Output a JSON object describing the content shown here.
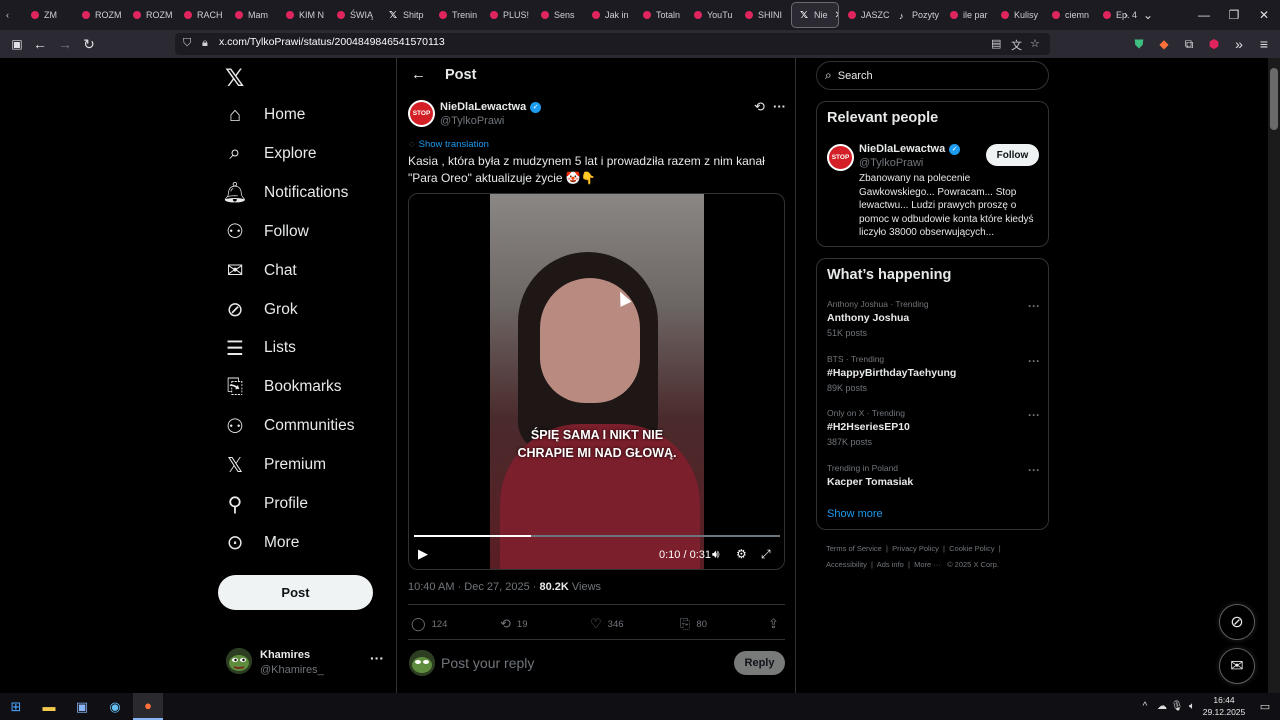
{
  "browser": {
    "tabs": [
      {
        "label": "ZM",
        "icon": "tab-favicon",
        "color": "#e0245e"
      },
      {
        "label": "ROZM",
        "icon": "youtube-favicon",
        "color": "#e0245e"
      },
      {
        "label": "ROZM",
        "icon": "youtube-favicon",
        "color": "#e0245e"
      },
      {
        "label": "RACH",
        "icon": "youtube-favicon",
        "color": "#e0245e"
      },
      {
        "label": "Mam",
        "icon": "youtube-favicon",
        "color": "#e0245e"
      },
      {
        "label": "KIM N",
        "icon": "youtube-favicon",
        "color": "#e0245e"
      },
      {
        "label": "ŚWIĄ",
        "icon": "youtube-favicon",
        "color": "#e0245e"
      },
      {
        "label": "Shitp",
        "icon": "x-favicon",
        "color": "#ffffff"
      },
      {
        "label": "Trenin",
        "icon": "youtube-favicon",
        "color": "#e0245e"
      },
      {
        "label": "PLUS!",
        "icon": "youtube-favicon",
        "color": "#e0245e"
      },
      {
        "label": "Sens",
        "icon": "youtube-favicon",
        "color": "#e0245e"
      },
      {
        "label": "Jak in",
        "icon": "youtube-favicon",
        "color": "#e0245e"
      },
      {
        "label": "Totaln",
        "icon": "youtube-favicon",
        "color": "#e0245e"
      },
      {
        "label": "YouTu",
        "icon": "youtube-favicon",
        "color": "#e0245e"
      },
      {
        "label": "SHINI",
        "icon": "youtube-favicon",
        "color": "#e0245e"
      }
    ],
    "active_tab": {
      "label": "Nie",
      "icon": "x-favicon"
    },
    "tabs_after": [
      {
        "label": "JASZC",
        "icon": "youtube-favicon",
        "color": "#e0245e"
      },
      {
        "label": "Pozyty",
        "icon": "tiktok-favicon",
        "color": "#ffffff"
      },
      {
        "label": "ile par",
        "icon": "youtube-favicon",
        "color": "#e0245e"
      },
      {
        "label": "Kulisy",
        "icon": "youtube-favicon",
        "color": "#e0245e"
      },
      {
        "label": "ciemn",
        "icon": "youtube-favicon",
        "color": "#e0245e"
      },
      {
        "label": "Ep. 4",
        "icon": "youtube-favicon",
        "color": "#e0245e"
      }
    ],
    "url": "x.com/TylkoPrawi/status/2004849846541570113"
  },
  "nav": {
    "items": [
      {
        "label": "Home",
        "icon": "home-icon"
      },
      {
        "label": "Explore",
        "icon": "search-icon"
      },
      {
        "label": "Notifications",
        "icon": "bell-icon"
      },
      {
        "label": "Follow",
        "icon": "person-add-icon"
      },
      {
        "label": "Chat",
        "icon": "mail-icon"
      },
      {
        "label": "Grok",
        "icon": "grok-icon"
      },
      {
        "label": "Lists",
        "icon": "list-icon"
      },
      {
        "label": "Bookmarks",
        "icon": "bookmark-icon"
      },
      {
        "label": "Communities",
        "icon": "communities-icon"
      },
      {
        "label": "Premium",
        "icon": "x-logo-icon"
      },
      {
        "label": "Profile",
        "icon": "person-icon"
      },
      {
        "label": "More",
        "icon": "more-circle-icon"
      }
    ],
    "post_button": "Post",
    "account": {
      "name": "Khamires",
      "handle": "@Khamires_"
    }
  },
  "post": {
    "header_title": "Post",
    "author_name": "NieDlaLewactwa",
    "author_handle": "@TylkoPrawi",
    "avatar_text": "STOP",
    "show_translation": "Show translation",
    "text": "Kasia , która była z mudzynem 5 lat i prowadziła razem z nim kanał \"Para Oreo\"  aktualizuje życie 🤡👇",
    "video_caption": "ŚPIĘ SAMA I NIKT NIE CHRAPIE MI NAD GŁOWĄ.",
    "video_time": "0:10 / 0:31",
    "video_progress": 0.32,
    "timestamp": "10:40 AM · Dec 27, 2025 · ",
    "views_count": "80.2K",
    "views_label": " Views",
    "actions": {
      "replies": "124",
      "reposts": "19",
      "likes": "346",
      "bookmarks": "80"
    },
    "reply_placeholder": "Post your reply",
    "reply_button": "Reply"
  },
  "sidebar": {
    "search_placeholder": "Search",
    "relevant_title": "Relevant people",
    "relevant": {
      "name": "NieDlaLewactwa",
      "handle": "@TylkoPrawi",
      "avatar_text": "STOP",
      "bio": "Zbanowany na polecenie Gawkowskiego... Powracam... Stop lewactwu... Ludzi prawych proszę o pomoc w odbudowie konta które kiedyś liczyło 38000 obserwujących...",
      "follow_label": "Follow"
    },
    "happening_title": "What’s happening",
    "trends": [
      {
        "context": "Anthony Joshua · Trending",
        "title": "Anthony Joshua",
        "count": "51K posts"
      },
      {
        "context": "BTS · Trending",
        "title": "#HappyBirthdayTaehyung",
        "count": "89K posts"
      },
      {
        "context": "Only on X · Trending",
        "title": "#H2HseriesEP10",
        "count": "387K posts"
      },
      {
        "context": "Trending in Poland",
        "title": "Kacper Tomasiak",
        "count": ""
      }
    ],
    "show_more": "Show more",
    "footer": {
      "terms": "Terms of Service",
      "privacy": "Privacy Policy",
      "cookie": "Cookie Policy",
      "accessibility": "Accessibility",
      "ads": "Ads info",
      "more": "More ···",
      "copyright": "© 2025 X Corp."
    }
  },
  "taskbar": {
    "time": "16:44",
    "date": "29.12.2025"
  },
  "colors": {
    "accent": "#1d9bf0",
    "background": "#000000",
    "border": "#2f3336",
    "muted": "#71767b"
  }
}
